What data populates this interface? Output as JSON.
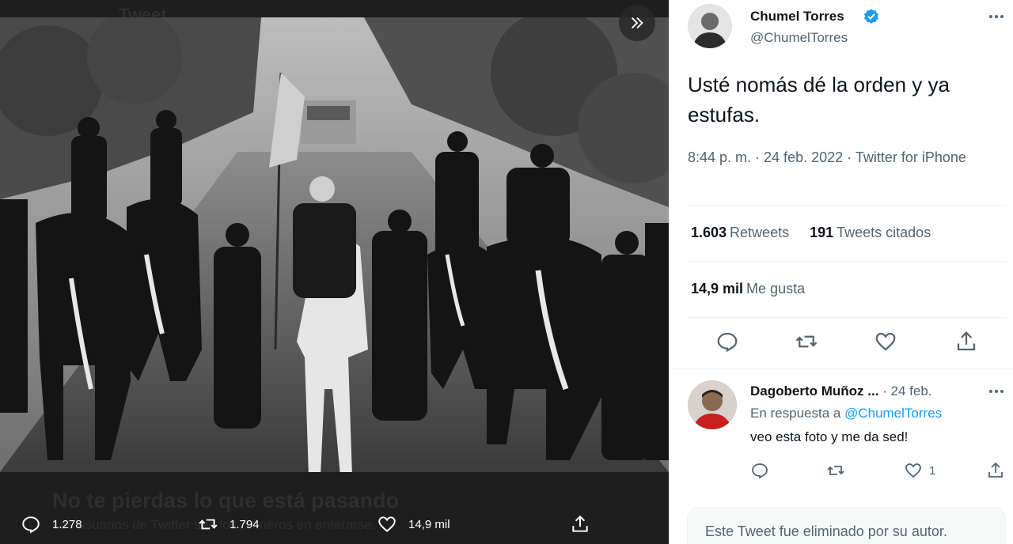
{
  "viewer": {
    "backdrop_top": "Tweet",
    "backdrop_title": "No te pierdas lo que está pasando",
    "backdrop_sub": "Los usuarios de Twitter son los primeros en enterarse.",
    "actions": {
      "reply_count": "1.278",
      "retweet_count": "1.794",
      "like_count": "14,9 mil"
    }
  },
  "tweet": {
    "author_name": "Chumel Torres",
    "author_handle": "@ChumelTorres",
    "text": "Usté nomás dé la orden y ya estufas.",
    "time": "8:44 p. m. · 24 feb. 2022 · ",
    "source": "Twitter for iPhone",
    "retweets_value": "1.603",
    "retweets_label": "Retweets",
    "quotes_value": "191",
    "quotes_label": "Tweets citados",
    "likes_value": "14,9 mil",
    "likes_label": "Me gusta"
  },
  "reply": {
    "author_name": "Dagoberto Muñoz ...",
    "date": " · 24 feb.",
    "reply_prefix": "En respuesta a ",
    "mention": "@ChumelTorres",
    "text": "veo esta foto y me da sed!",
    "like_count": "1"
  },
  "deleted_notice": "Este Tweet fue eliminado por su autor.",
  "colors": {
    "accent": "#1d9bf0",
    "text_primary": "#0f1419",
    "text_secondary": "#536471",
    "viewer_bg": "#1e1e1e"
  }
}
